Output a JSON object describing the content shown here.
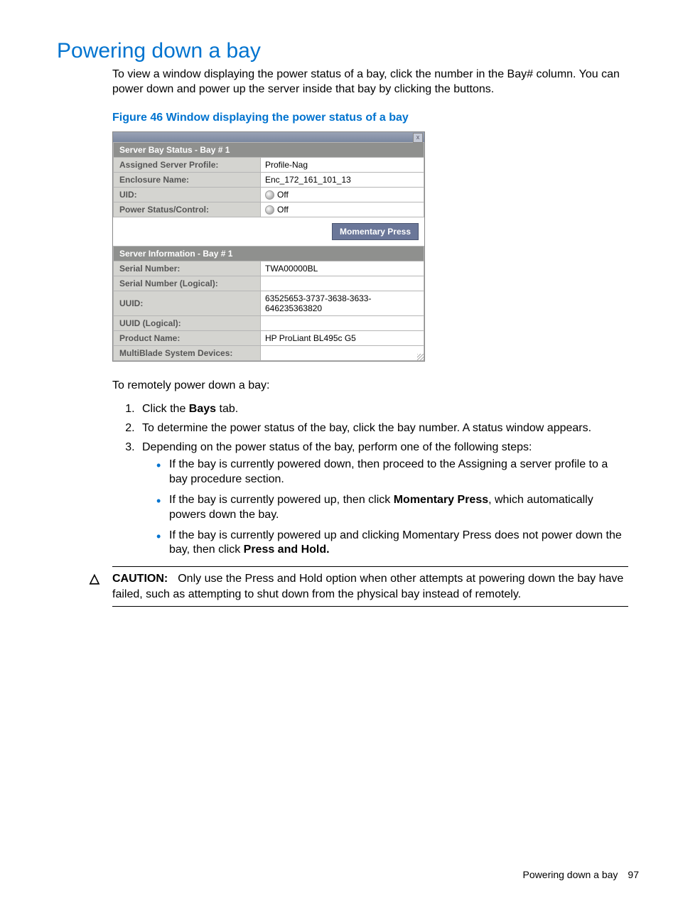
{
  "heading": "Powering down a bay",
  "intro": "To view a window displaying the power status of a bay, click the number in the Bay# column. You can power down and power up the server inside that bay by clicking the buttons.",
  "figure_caption": "Figure 46 Window displaying the power status of a bay",
  "dialog": {
    "close_glyph": "x",
    "sec1_header": "Server Bay Status - Bay # 1",
    "rows1": {
      "profile_label": "Assigned Server Profile:",
      "profile_value": "Profile-Nag",
      "encl_label": "Enclosure Name:",
      "encl_value": "Enc_172_161_101_13",
      "uid_label": "UID:",
      "uid_value": "Off",
      "power_label": "Power Status/Control:",
      "power_value": "Off"
    },
    "button": "Momentary Press",
    "sec2_header": "Server Information - Bay # 1",
    "rows2": {
      "sn_label": "Serial Number:",
      "sn_value": "TWA00000BL",
      "snl_label": "Serial Number (Logical):",
      "snl_value": "",
      "uuid_label": "UUID:",
      "uuid_value": "63525653-3737-3638-3633-646235363820",
      "uuidl_label": "UUID (Logical):",
      "uuidl_value": "",
      "prod_label": "Product Name:",
      "prod_value": "HP ProLiant BL495c G5",
      "mb_label": "MultiBlade System Devices:",
      "mb_value": ""
    }
  },
  "para2": "To remotely power down a bay:",
  "steps": {
    "s1a": "Click the ",
    "s1b": "Bays",
    "s1c": " tab.",
    "s2": "To determine the power status of the bay, click the bay number. A status window appears.",
    "s3": "Depending on the power status of the bay, perform one of the following steps:"
  },
  "bullets": {
    "b1": "If the bay is currently powered down, then proceed to the Assigning a server profile to a bay procedure section.",
    "b2a": "If the bay is currently powered up, then click ",
    "b2b": "Momentary Press",
    "b2c": ", which automatically powers down the bay.",
    "b3a": "If the bay is currently powered up and clicking Momentary Press does not power down the bay, then click ",
    "b3b": "Press and Hold."
  },
  "caution": {
    "lead": "CAUTION:",
    "text": "Only use the Press and Hold option when other attempts at powering down the bay have failed, such as attempting to shut down from the physical bay instead of remotely."
  },
  "footer": {
    "title": "Powering down a bay",
    "page": "97"
  }
}
